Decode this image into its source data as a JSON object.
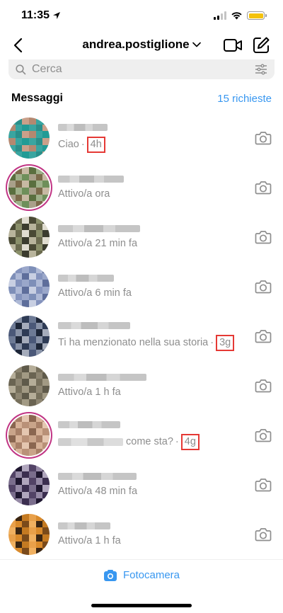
{
  "status_bar": {
    "time": "11:35"
  },
  "header": {
    "username": "andrea.postiglione"
  },
  "search": {
    "placeholder": "Cerca"
  },
  "section": {
    "title": "Messaggi",
    "requests": "15 richieste"
  },
  "conversations": [
    {
      "subtitle": "Ciao",
      "timestamp": "4h",
      "avatar_colors": [
        "#3aa5a0",
        "#2a8f8a",
        "#caa08a",
        "#b48870",
        "#3aa5a0",
        "#229b95"
      ]
    },
    {
      "subtitle": "Attivo/a ora",
      "timestamp": "",
      "avatar_colors": [
        "#6e8f5a",
        "#a9a08a",
        "#7b6a4a",
        "#c7b9a3",
        "#5a6f3f",
        "#9fb08a"
      ]
    },
    {
      "subtitle": "Attivo/a 21 min fa",
      "timestamp": "",
      "avatar_colors": [
        "#8a8f6a",
        "#3b3c2e",
        "#b8b49c",
        "#6b6b4f",
        "#e0ddd0",
        "#4a4a35"
      ]
    },
    {
      "subtitle": "Attivo/a 6 min fa",
      "timestamp": "",
      "avatar_colors": [
        "#7e8fb8",
        "#aeb9d6",
        "#5e6e9b",
        "#c8cfe2",
        "#8493bd",
        "#9aa7ca"
      ]
    },
    {
      "subtitle": "Ti ha menzionato nella sua storia",
      "timestamp": "3g",
      "avatar_colors": [
        "#2e3b55",
        "#6d7a95",
        "#1d2638",
        "#a5acbb",
        "#4a5878",
        "#8892a7"
      ]
    },
    {
      "subtitle": "Attivo/a 1 h fa",
      "timestamp": "",
      "avatar_colors": [
        "#8e8672",
        "#5f5a4a",
        "#b5ad98",
        "#77705c",
        "#a29a84",
        "#6a6452"
      ]
    },
    {
      "subtitle": "come sta?",
      "timestamp": "4g",
      "avatar_colors": [
        "#c9a48a",
        "#a88068",
        "#e4c6b0",
        "#8a6650",
        "#d7b298",
        "#b99178"
      ]
    },
    {
      "subtitle": "Attivo/a 48 min fa",
      "timestamp": "",
      "avatar_colors": [
        "#3b2e4f",
        "#7a6d8c",
        "#1f1730",
        "#b0a6bd",
        "#524366",
        "#968aa6"
      ]
    },
    {
      "subtitle": "Attivo/a 1 h fa",
      "timestamp": "",
      "avatar_colors": [
        "#d98a2b",
        "#7a4a1a",
        "#f0b060",
        "#3a2512",
        "#c47a22",
        "#e8a04a"
      ]
    }
  ],
  "bottom_bar": {
    "camera_label": "Fotocamera"
  },
  "colors": {
    "accent": "#3897f0",
    "highlight_box": "#e53935",
    "battery": "#f4c20d"
  },
  "icons": [
    "location-arrow-icon",
    "chevron-left-icon",
    "chevron-down-icon",
    "video-camera-icon",
    "compose-icon",
    "search-icon",
    "filter-icon",
    "camera-icon"
  ]
}
